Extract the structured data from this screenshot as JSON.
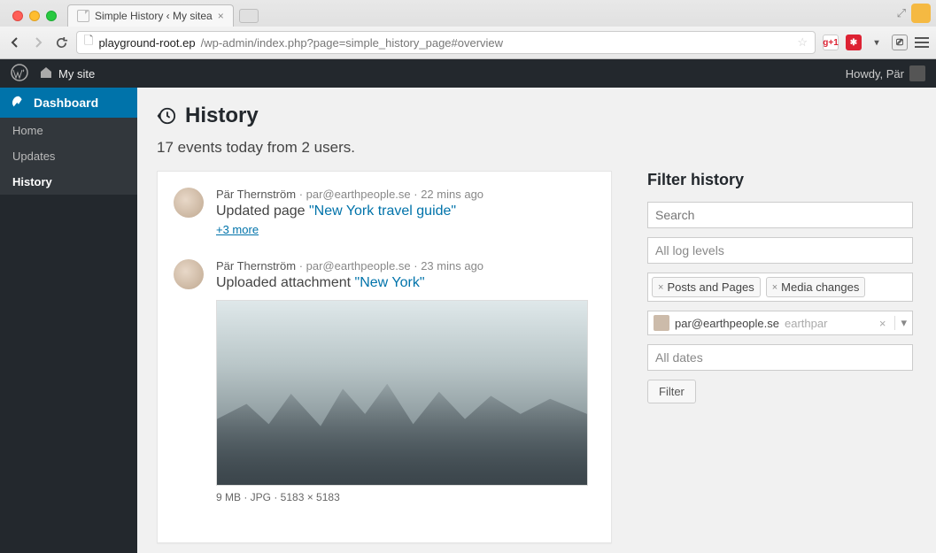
{
  "browser": {
    "tab_title": "Simple History ‹ My sitea",
    "url_host": "playground-root.ep",
    "url_path": "/wp-admin/index.php?page=simple_history_page#overview"
  },
  "admin_bar": {
    "site_name": "My site",
    "greeting": "Howdy, Pär"
  },
  "sidebar": {
    "dashboard": "Dashboard",
    "items": [
      {
        "label": "Home"
      },
      {
        "label": "Updates"
      },
      {
        "label": "History"
      }
    ]
  },
  "page": {
    "title": "History",
    "summary": "17 events today from 2 users."
  },
  "events": [
    {
      "author": "Pär Thernström",
      "email": "par@earthpeople.se",
      "time": "22 mins ago",
      "action_prefix": "Updated page ",
      "link_text": "\"New York travel guide\"",
      "more": "+3 more"
    },
    {
      "author": "Pär Thernström",
      "email": "par@earthpeople.se",
      "time": "23 mins ago",
      "action_prefix": "Uploaded attachment ",
      "link_text": "\"New York\"",
      "file_meta": "9 MB · JPG · 5183 × 5183"
    }
  ],
  "filter": {
    "heading": "Filter history",
    "search_placeholder": "Search",
    "levels_placeholder": "All log levels",
    "tags": [
      "Posts and Pages",
      "Media changes"
    ],
    "user_email": "par@earthpeople.se",
    "user_search": "earthpar",
    "dates_placeholder": "All dates",
    "button": "Filter"
  }
}
